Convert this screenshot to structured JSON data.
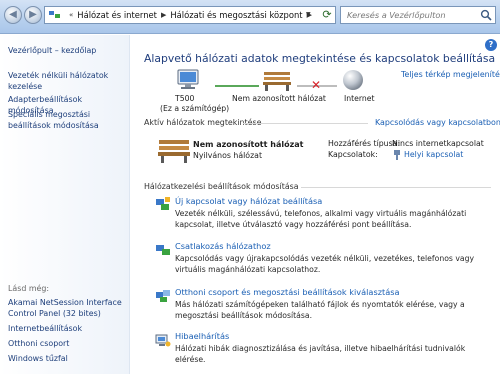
{
  "addressbar": {
    "crumbs": [
      "Hálózat és internet",
      "Hálózati és megosztási központ"
    ],
    "search_placeholder": "Keresés a Vezérlőpulton"
  },
  "sidebar": {
    "home": "Vezérlőpult – kezdőlap",
    "links": [
      "Vezeték nélküli hálózatok kezelése",
      "Adapterbeállítások módosítása",
      "Speciális megosztási beállítások módosítása"
    ],
    "see_also_label": "Lásd még:",
    "see_also": [
      "Akamai NetSession Interface Control Panel (32 bites)",
      "Internetbeállítások",
      "Otthoni csoport",
      "Windows tűzfal"
    ]
  },
  "main": {
    "title": "Alapvető hálózati adatok megtekintése és kapcsolatok beállítása",
    "full_map_link": "Teljes térkép megjelenítése",
    "map": {
      "computer_name": "T500",
      "computer_sub": "(Ez a számítógép)",
      "network_name": "Nem azonosított hálózat",
      "internet_label": "Internet"
    },
    "active_networks": {
      "title": "Aktív hálózatok megtekintése",
      "connect_link": "Kapcsolódás vagy kapcsolatbontás",
      "network_name": "Nem azonosított hálózat",
      "network_type": "Nyilvános hálózat",
      "access_type_label": "Hozzáférés típusa:",
      "access_type_value": "Nincs internetkapcsolat",
      "connections_label": "Kapcsolatok:",
      "connections_value": "Helyi kapcsolat"
    },
    "settings": {
      "title": "Hálózatkezelési beállítások módosítása",
      "tasks": [
        {
          "title": "Új kapcsolat vagy hálózat beállítása",
          "desc": "Vezeték nélküli, szélessávú, telefonos, alkalmi vagy virtuális magánhálózati kapcsolat, illetve útválasztó vagy hozzáférési pont beállítása."
        },
        {
          "title": "Csatlakozás hálózathoz",
          "desc": "Kapcsolódás vagy újrakapcsolódás vezeték nélküli, vezetékes, telefonos vagy virtuális magánhálózati kapcsolathoz."
        },
        {
          "title": "Otthoni csoport és megosztási beállítások kiválasztása",
          "desc": "Más hálózati számítógépeken található fájlok és nyomtatók elérése, vagy a megosztási beállítások módosítása."
        },
        {
          "title": "Hibaelhárítás",
          "desc": "Hálózati hibák diagnosztizálása és javítása, illetve hibaelhárítási tudnivalók elérése."
        }
      ]
    }
  }
}
